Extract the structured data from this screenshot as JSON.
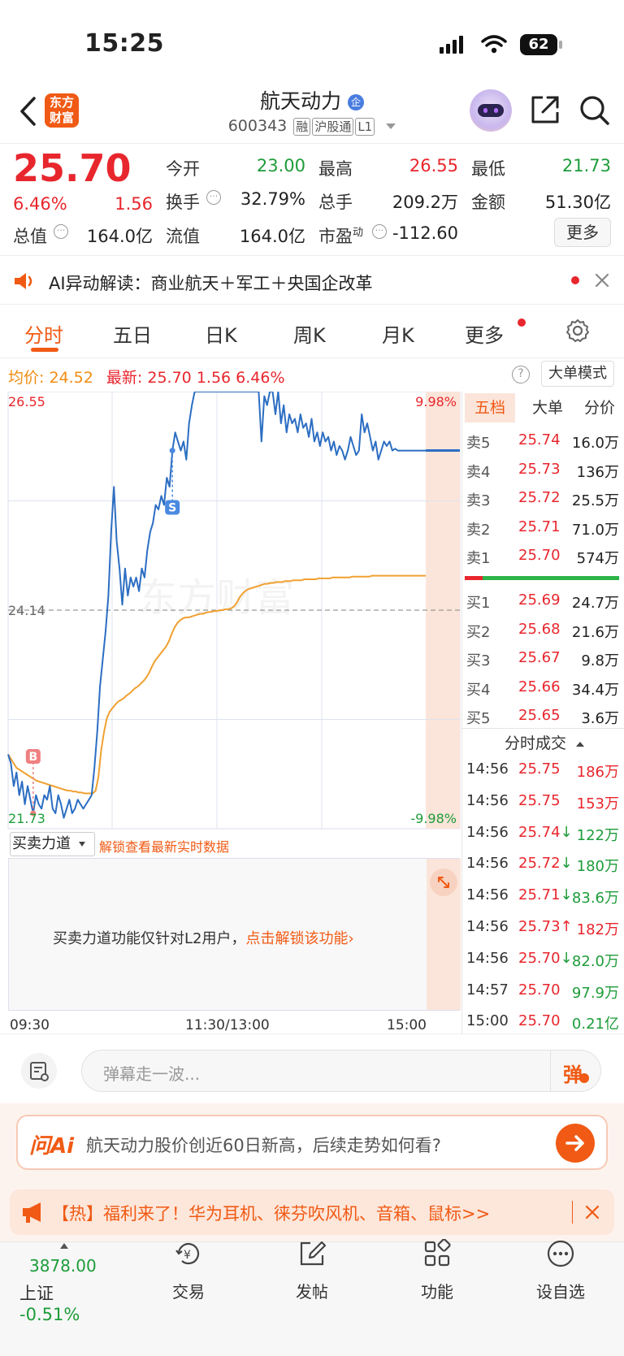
{
  "status_bar": {
    "time": "15:25",
    "battery": "62"
  },
  "header": {
    "logo_line1": "东方",
    "logo_line2": "财富",
    "stock_name": "航天动力",
    "badge": "企",
    "stock_code": "600343",
    "tags": [
      "融",
      "沪股通",
      "L1"
    ]
  },
  "quote": {
    "price": "25.70",
    "change_pct": "6.46%",
    "change": "1.56",
    "open_label": "今开",
    "open": "23.00",
    "high_label": "最高",
    "high": "26.55",
    "low_label": "最低",
    "low": "21.73",
    "turnover_label": "换手",
    "turnover": "32.79%",
    "volume_label": "总手",
    "volume": "209.2万",
    "amount_label": "金额",
    "amount": "51.30亿",
    "mcap_label": "总值",
    "mcap": "164.0亿",
    "float_label": "流值",
    "float": "164.0亿",
    "pe_label": "市盈",
    "pe_sup": "动",
    "pe": "-112.60",
    "more_button": "更多"
  },
  "ai_banner": {
    "text": "AI异动解读：商业航天＋军工＋央国企改革"
  },
  "tabs": [
    "分时",
    "五日",
    "日K",
    "周K",
    "月K",
    "更多"
  ],
  "active_tab": "分时",
  "info_line": {
    "avg_label": "均价:",
    "avg": "24.52",
    "latest_label": "最新:",
    "latest": "25.70",
    "change": "1.56",
    "pct": "6.46%",
    "big_order_mode": "大单模式"
  },
  "chart_data": {
    "type": "line",
    "title": "",
    "ylim": [
      21.73,
      26.55
    ],
    "y_top_label": "26.55",
    "y_mid_label": "24.14",
    "y_bottom_label": "21.73",
    "pct_top_label": "9.98%",
    "pct_bottom_label": "-9.98%",
    "x_labels": [
      "09:30",
      "11:30/13:00",
      "15:00"
    ],
    "watermark": "东方财富",
    "buy_marker": "B",
    "sell_marker": "S",
    "series": [
      {
        "name": "最新",
        "color": "#2c6ec2",
        "values": [
          22.55,
          22.45,
          22.2,
          22.35,
          22.1,
          22.25,
          22.0,
          22.2,
          22.05,
          21.9,
          22.1,
          22.0,
          21.95,
          22.1,
          22.05,
          22.2,
          21.95,
          21.9,
          22.1,
          22.0,
          21.85,
          21.95,
          22.05,
          21.9,
          21.95,
          22.05,
          22.0,
          21.95,
          22.0,
          22.05,
          22.1,
          22.4,
          22.8,
          23.3,
          23.6,
          23.9,
          24.3,
          25.0,
          25.5,
          24.9,
          24.6,
          24.2,
          24.6,
          24.3,
          24.5,
          24.4,
          24.5,
          24.35,
          24.6,
          24.5,
          24.8,
          25.0,
          25.1,
          25.3,
          25.25,
          25.4,
          25.3,
          25.6,
          25.5,
          25.9,
          26.1,
          26.0,
          25.9,
          26.0,
          25.8,
          26.2,
          26.4,
          26.55,
          26.55,
          26.55,
          26.55,
          26.55,
          26.55,
          26.55,
          26.55,
          26.55,
          26.55,
          26.55,
          26.55,
          26.55,
          26.55,
          26.55,
          26.55,
          26.55,
          26.55,
          26.55,
          26.55,
          26.55,
          26.55,
          26.55,
          26.55,
          26.0,
          26.5,
          26.4,
          26.55,
          26.55,
          26.3,
          26.55,
          26.2,
          26.4,
          26.1,
          26.3,
          26.2,
          26.25,
          26.1,
          26.3,
          26.15,
          26.2,
          26.05,
          26.25,
          26.0,
          26.1,
          25.95,
          26.1,
          26.0,
          26.05,
          25.9,
          26.0,
          25.85,
          25.95,
          25.9,
          25.8,
          25.9,
          26.05,
          25.95,
          25.85,
          25.9,
          26.3,
          26.1,
          26.2,
          26.05,
          25.9,
          26.0,
          25.8,
          25.9,
          26.0,
          25.95,
          26.0,
          25.9,
          25.92,
          25.9,
          25.9,
          25.9,
          25.9,
          25.9,
          25.9,
          25.9,
          25.9,
          25.9,
          25.9,
          25.9
        ]
      },
      {
        "name": "均价",
        "color": "#f0a030",
        "values": [
          22.55,
          22.5,
          22.45,
          22.4,
          22.38,
          22.36,
          22.34,
          22.32,
          22.3,
          22.28,
          22.26,
          22.25,
          22.24,
          22.23,
          22.22,
          22.21,
          22.2,
          22.19,
          22.18,
          22.17,
          22.16,
          22.15,
          22.15,
          22.14,
          22.14,
          22.13,
          22.13,
          22.12,
          22.12,
          22.12,
          22.12,
          22.15,
          22.3,
          22.6,
          22.8,
          22.95,
          23.02,
          23.06,
          23.1,
          23.13,
          23.15,
          23.17,
          23.2,
          23.22,
          23.25,
          23.28,
          23.3,
          23.33,
          23.36,
          23.4,
          23.45,
          23.52,
          23.58,
          23.62,
          23.66,
          23.7,
          23.74,
          23.8,
          23.88,
          23.95,
          24.0,
          24.03,
          24.05,
          24.06,
          24.06,
          24.07,
          24.08,
          24.09,
          24.1,
          24.1,
          24.11,
          24.12,
          24.12,
          24.13,
          24.13,
          24.14,
          24.14,
          24.15,
          24.15,
          24.16,
          24.18,
          24.22,
          24.28,
          24.32,
          24.35,
          24.37,
          24.38,
          24.39,
          24.4,
          24.41,
          24.42,
          24.43,
          24.43,
          24.44,
          24.44,
          24.45,
          24.45,
          24.45,
          24.46,
          24.46,
          24.46,
          24.47,
          24.47,
          24.47,
          24.47,
          24.48,
          24.48,
          24.48,
          24.48,
          24.48,
          24.49,
          24.49,
          24.49,
          24.49,
          24.49,
          24.5,
          24.5,
          24.5,
          24.5,
          24.5,
          24.5,
          24.5,
          24.51,
          24.51,
          24.51,
          24.51,
          24.51,
          24.51,
          24.51,
          24.52,
          24.52,
          24.52,
          24.52,
          24.52,
          24.52,
          24.52,
          24.52,
          24.52,
          24.52,
          24.52,
          24.52,
          24.52,
          24.52,
          24.52,
          24.52,
          24.52,
          24.52,
          24.52,
          24.52
        ]
      }
    ]
  },
  "order_book": {
    "tabs": [
      "五档",
      "大单",
      "分价"
    ],
    "asks": [
      {
        "label": "卖5",
        "price": "25.74",
        "vol": "16.0万"
      },
      {
        "label": "卖4",
        "price": "25.73",
        "vol": "136万"
      },
      {
        "label": "卖3",
        "price": "25.72",
        "vol": "25.5万"
      },
      {
        "label": "卖2",
        "price": "25.71",
        "vol": "71.0万"
      },
      {
        "label": "卖1",
        "price": "25.70",
        "vol": "574万"
      }
    ],
    "bids": [
      {
        "label": "买1",
        "price": "25.69",
        "vol": "24.7万"
      },
      {
        "label": "买2",
        "price": "25.68",
        "vol": "21.6万"
      },
      {
        "label": "买3",
        "price": "25.67",
        "vol": "9.8万"
      },
      {
        "label": "买4",
        "price": "25.66",
        "vol": "34.4万"
      },
      {
        "label": "买5",
        "price": "25.65",
        "vol": "3.6万"
      }
    ],
    "ticks_title": "分时成交",
    "ticks": [
      {
        "time": "14:56",
        "price": "25.75",
        "arrow": "",
        "vol": "186万",
        "color": "red"
      },
      {
        "time": "14:56",
        "price": "25.75",
        "arrow": "",
        "vol": "153万",
        "color": "red"
      },
      {
        "time": "14:56",
        "price": "25.74",
        "arrow": "↓",
        "vol": "122万",
        "color": "green"
      },
      {
        "time": "14:56",
        "price": "25.72",
        "arrow": "↓",
        "vol": "180万",
        "color": "green"
      },
      {
        "time": "14:56",
        "price": "25.71",
        "arrow": "↓",
        "vol": "83.6万",
        "color": "green"
      },
      {
        "time": "14:56",
        "price": "25.73",
        "arrow": "↑",
        "vol": "182万",
        "color": "red"
      },
      {
        "time": "14:56",
        "price": "25.70",
        "arrow": "↓",
        "vol": "82.0万",
        "color": "green"
      },
      {
        "time": "14:57",
        "price": "25.70",
        "arrow": "",
        "vol": "97.9万",
        "color": "green"
      },
      {
        "time": "15:00",
        "price": "25.70",
        "arrow": "",
        "vol": "0.21亿",
        "color": "green"
      }
    ]
  },
  "power_panel": {
    "selector": "买卖力道",
    "unlock_link": "解锁查看最新实时数据",
    "notice": "买卖力道功能仅针对L2用户，",
    "notice_link": "点击解锁该功能"
  },
  "comment_bar": {
    "placeholder": "弹幕走一波...",
    "danmu": "弹"
  },
  "ask_ai": {
    "logo": "问Ai",
    "text": "航天动力股价创近60日新高，后续走势如何看?"
  },
  "promo": {
    "text": "【热】福利来了！华为耳机、徕芬吹风机、音箱、鼠标>>"
  },
  "bottom_nav": {
    "index_value": "3878.00",
    "index_name": "上证",
    "index_change": "-0.51%",
    "items": [
      "交易",
      "发帖",
      "功能",
      "设自选"
    ]
  },
  "colors": {
    "up": "#e8262d",
    "down": "#1e9c3a",
    "accent": "#f05a14",
    "price_line": "#2c6ec2",
    "avg_line": "#f0a030"
  }
}
